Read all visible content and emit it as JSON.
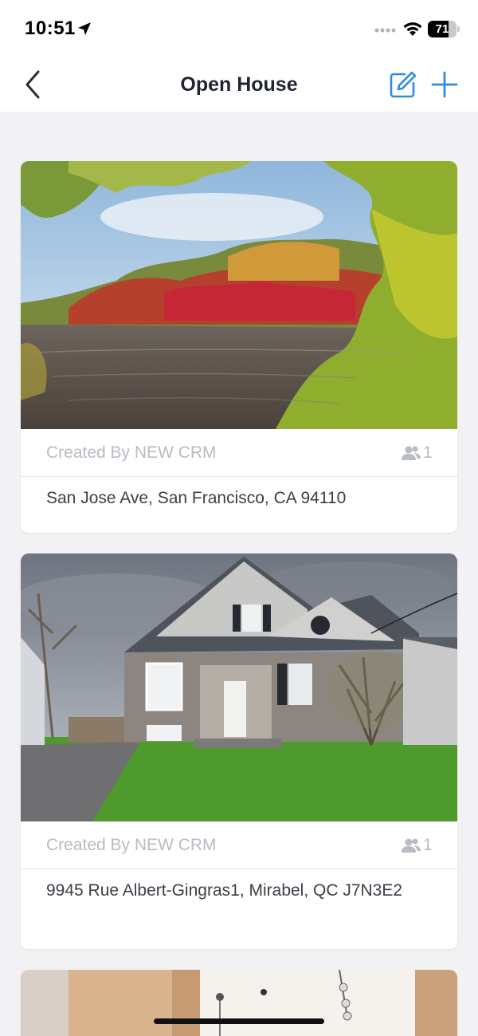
{
  "status_bar": {
    "time": "10:51",
    "battery": "71",
    "battery_level": 0.71
  },
  "nav": {
    "title": "Open House"
  },
  "listings": [
    {
      "creator": "Created By NEW CRM",
      "attendees": "1",
      "address": "San Jose Ave, San Francisco, CA 94110"
    },
    {
      "creator": "Created By NEW CRM",
      "attendees": "1",
      "address": "9945 Rue Albert-Gingras1, Mirabel, QC J7N3E2"
    }
  ],
  "icons": {
    "back": "chevron-left-icon",
    "edit": "edit-icon",
    "add": "plus-icon",
    "attendees": "people-icon"
  },
  "colors": {
    "accent": "#2f8ae6",
    "title": "#1f2530",
    "muted": "#b8bcc3",
    "background": "#f2f2f5"
  }
}
